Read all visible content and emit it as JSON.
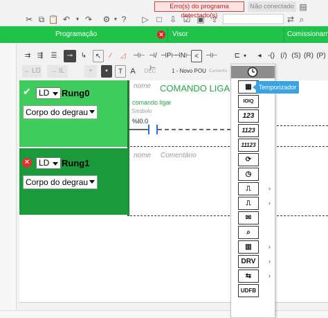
{
  "topbar": {
    "error_status": "Erro(s) do programa detectado(s)",
    "connection_status": "Não conectado",
    "icons": [
      "cut-icon",
      "copy-icon",
      "paste-icon",
      "undo-icon",
      "settings-icon",
      "help-icon",
      "run-icon",
      "stop-icon",
      "download-icon",
      "upload-icon"
    ]
  },
  "tabs": {
    "items": [
      {
        "label": "Programação"
      },
      {
        "label": "Visor"
      },
      {
        "label": "Comissionamento"
      }
    ]
  },
  "editor_toolbar": {
    "row2": {
      "ld_label": "LD",
      "il_label": "IL",
      "dec_label": "DEC",
      "pou_name": "1 - Novo POU",
      "comment_label": "Comentó"
    }
  },
  "rungs": [
    {
      "language": "LD",
      "name": "Rung0",
      "body_select": "Corpo do degrau",
      "name_placeholder": "nome",
      "comment": "COMANDO LIGAR",
      "variable_name": "comando ligar",
      "symbol_placeholder": "Símbolo",
      "address": "%I0.0",
      "status": "ok"
    },
    {
      "language": "LD",
      "name": "Rung1",
      "body_select": "Corpo do degrau",
      "name_placeholder": "nome",
      "comment_placeholder": "Comentário",
      "status": "error"
    }
  ],
  "function_block_menu": {
    "tooltip": "Temporizador",
    "items": [
      {
        "icon": "timer-icon",
        "label": "",
        "submenu": false
      },
      {
        "icon": "memory-block-icon",
        "label": "",
        "submenu": false
      },
      {
        "icon": "io-block-icon",
        "label": "IOIQ",
        "submenu": false
      },
      {
        "icon": "num-16bit-icon",
        "label": "123",
        "submenu": false
      },
      {
        "icon": "num-32bit-icon",
        "label": "1123",
        "submenu": false
      },
      {
        "icon": "num-64bit-icon",
        "label": "11123",
        "submenu": false
      },
      {
        "icon": "counter-icon",
        "label": "",
        "submenu": false
      },
      {
        "icon": "clock-icon",
        "label": "",
        "submenu": false
      },
      {
        "icon": "pulse-icon",
        "label": "",
        "submenu": true
      },
      {
        "icon": "step-icon",
        "label": "",
        "submenu": true
      },
      {
        "icon": "message-icon",
        "label": "",
        "submenu": false
      },
      {
        "icon": "search-icon",
        "label": "",
        "submenu": false
      },
      {
        "icon": "chart-icon",
        "label": "",
        "submenu": true
      },
      {
        "icon": "drive-icon",
        "label": "DRV",
        "submenu": true
      },
      {
        "icon": "exchange-icon",
        "label": "",
        "submenu": true
      },
      {
        "icon": "udfb-icon",
        "label": "UDFB",
        "submenu": false
      }
    ]
  }
}
